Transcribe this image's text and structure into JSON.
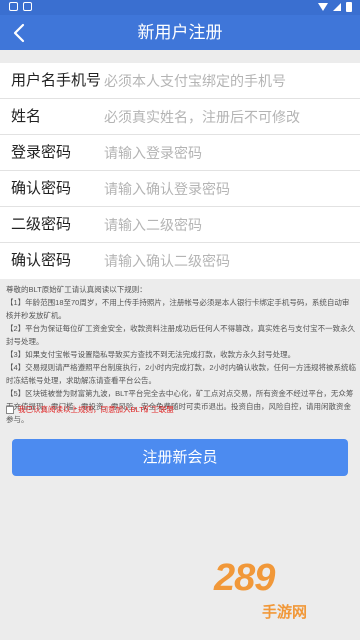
{
  "header": {
    "back_icon": "chevron-left-icon",
    "title": "新用户注册"
  },
  "form": {
    "fields": [
      {
        "label": "用户名手机号",
        "placeholder": "必须本人支付宝绑定的手机号"
      },
      {
        "label": "姓名",
        "placeholder": "必须真实姓名，注册后不可修改"
      },
      {
        "label": "登录密码",
        "placeholder": "请输入登录密码"
      },
      {
        "label": "确认密码",
        "placeholder": "请输入确认登录密码"
      },
      {
        "label": "二级密码",
        "placeholder": "请输入二级密码"
      },
      {
        "label": "确认密码",
        "placeholder": "请输入确认二级密码"
      }
    ]
  },
  "rules": {
    "intro": "尊敬的BLT原始矿工请认真阅读以下规则：",
    "items": [
      "【1】年龄范围18至70周岁，不用上传手持照片，注册帐号必须是本人银行卡绑定手机号码，系统自动审核并秒发放矿机。",
      "【2】平台为保证每位矿工资金安全，收款资料注册成功后任何人不得篡改，真实姓名与支付宝不一致永久封号处理。",
      "【3】如果支付宝帐号设置隐私导致买方查找不到无法完成打款，收款方永久封号处理。",
      "【4】交易规则请严格遵照平台制度执行，2小时内完成打款，2小时内确认收款，任何一方违规将被系统临时冻结帐号处理，求助解冻请查看平台公告。",
      "【5】区块链被誉为财富第九波，BLT平台完全去中心化，矿工点对点交易，所有资金不经过平台，无众筹无充值提现，零门槛，零投资，零风险，安全免费随时可卖币退出。投资自由，风险自控，请用闲散资金参与。"
    ],
    "agree_text": "我已认真阅读以上规则，同意加入BLT矿工联盟"
  },
  "submit_label": "注册新会员",
  "watermark": {
    "logo": "289",
    "suffix": "手游网"
  },
  "colors": {
    "header": "#3f76d9",
    "button": "#4c8bf0",
    "agree_text": "#e02424",
    "watermark": "#f28a1a"
  }
}
